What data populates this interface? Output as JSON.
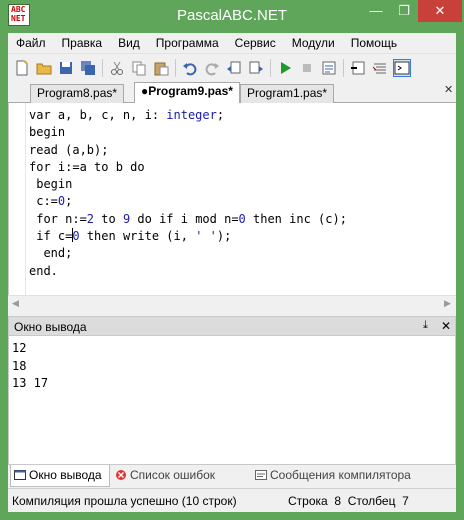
{
  "window": {
    "title": "PascalABC.NET",
    "icon_text": [
      "ABC",
      "NET"
    ],
    "controls": [
      "—",
      "❐",
      "✕"
    ]
  },
  "menu": [
    "Файл",
    "Правка",
    "Вид",
    "Программа",
    "Сервис",
    "Модули",
    "Помощь"
  ],
  "toolbar": {
    "buttons": [
      "new-file-icon",
      "open-folder-icon",
      "save-icon",
      "save-all-icon",
      "cut-icon",
      "copy-icon",
      "paste-icon",
      "undo-icon",
      "redo-icon",
      "back-icon",
      "forward-icon",
      "run-icon",
      "stop-icon",
      "compile-icon",
      "debug-icon",
      "format-icon",
      "output-window-icon"
    ]
  },
  "tabs": [
    {
      "label": "Program8.pas*",
      "active": false
    },
    {
      "label": "●Program9.pas*",
      "active": true
    },
    {
      "label": "Program1.pas*",
      "active": false
    }
  ],
  "tab_close_glyph": "✕",
  "editor": {
    "lines": [
      "var a, b, c, n, i: integer;",
      "begin",
      "read (a,b);",
      "for i:=a to b do",
      " begin",
      " c:=0;",
      " for n:=2 to 9 do if i mod n=0 then inc (c);",
      " if c=0 then write (i, ' ');",
      "  end;",
      "end."
    ]
  },
  "output_panel": {
    "title": "Окно вывода",
    "pin_glyph": "📌",
    "close_glyph": "✕",
    "lines": [
      "12",
      "18",
      "13 17"
    ]
  },
  "bottom_tabs": [
    {
      "label": "Окно вывода",
      "active": true
    },
    {
      "label": "Список ошибок",
      "active": false
    },
    {
      "label": "Сообщения компилятора",
      "active": false
    }
  ],
  "status": {
    "message": "Компиляция прошла успешно (10 строк)",
    "row_label": "Строка",
    "row_value": "8",
    "col_label": "Столбец",
    "col_value": "7"
  },
  "colors": {
    "titlebar": "#5fa55a",
    "close_button": "#c7403a",
    "keyword_type": "#1a1aa8"
  }
}
